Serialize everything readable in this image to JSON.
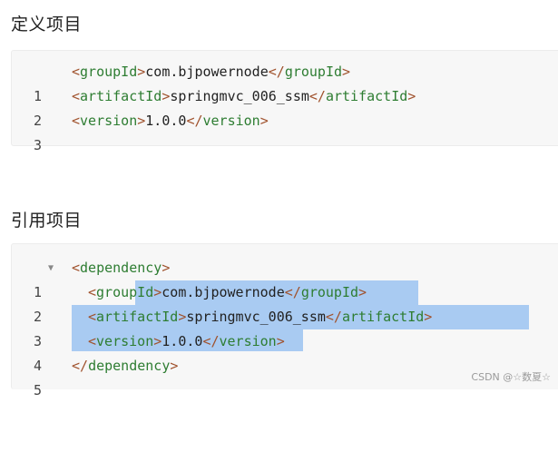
{
  "sections": [
    {
      "heading": "定义项目",
      "lines": [
        {
          "num": "1",
          "open": "<",
          "tag": "groupId",
          "close_open": ">",
          "text": "com.bjpowernode",
          "end_open": "</",
          "end_tag": "groupId",
          "end_close": ">"
        },
        {
          "num": "2",
          "open": "<",
          "tag": "artifactId",
          "close_open": ">",
          "text": "springmvc_006_ssm",
          "end_open": "</",
          "end_tag": "artifactId",
          "end_close": ">"
        },
        {
          "num": "3",
          "open": "<",
          "tag": "version",
          "close_open": ">",
          "text": "1.0.0",
          "end_open": "</",
          "end_tag": "version",
          "end_close": ">"
        }
      ]
    },
    {
      "heading": "引用项目",
      "lines": [
        {
          "num": "1",
          "fold": "▼",
          "open": "<",
          "tag": "dependency",
          "close_open": ">"
        },
        {
          "num": "2",
          "open": "<",
          "tag": "groupId",
          "close_open": ">",
          "text": "com.bjpowernode",
          "end_open": "</",
          "end_tag": "groupId",
          "end_close": ">"
        },
        {
          "num": "3",
          "open": "<",
          "tag": "artifactId",
          "close_open": ">",
          "text": "springmvc_006_ssm",
          "end_open": "</",
          "end_tag": "artifactId",
          "end_close": ">"
        },
        {
          "num": "4",
          "open": "<",
          "tag": "version",
          "close_open": ">",
          "text": "1.0.0",
          "end_open": "</",
          "end_tag": "version",
          "end_close": ">"
        },
        {
          "num": "5",
          "open": "</",
          "tag": "dependency",
          "close_open": ">"
        }
      ]
    }
  ],
  "watermark": "CSDN @☆数夏☆"
}
